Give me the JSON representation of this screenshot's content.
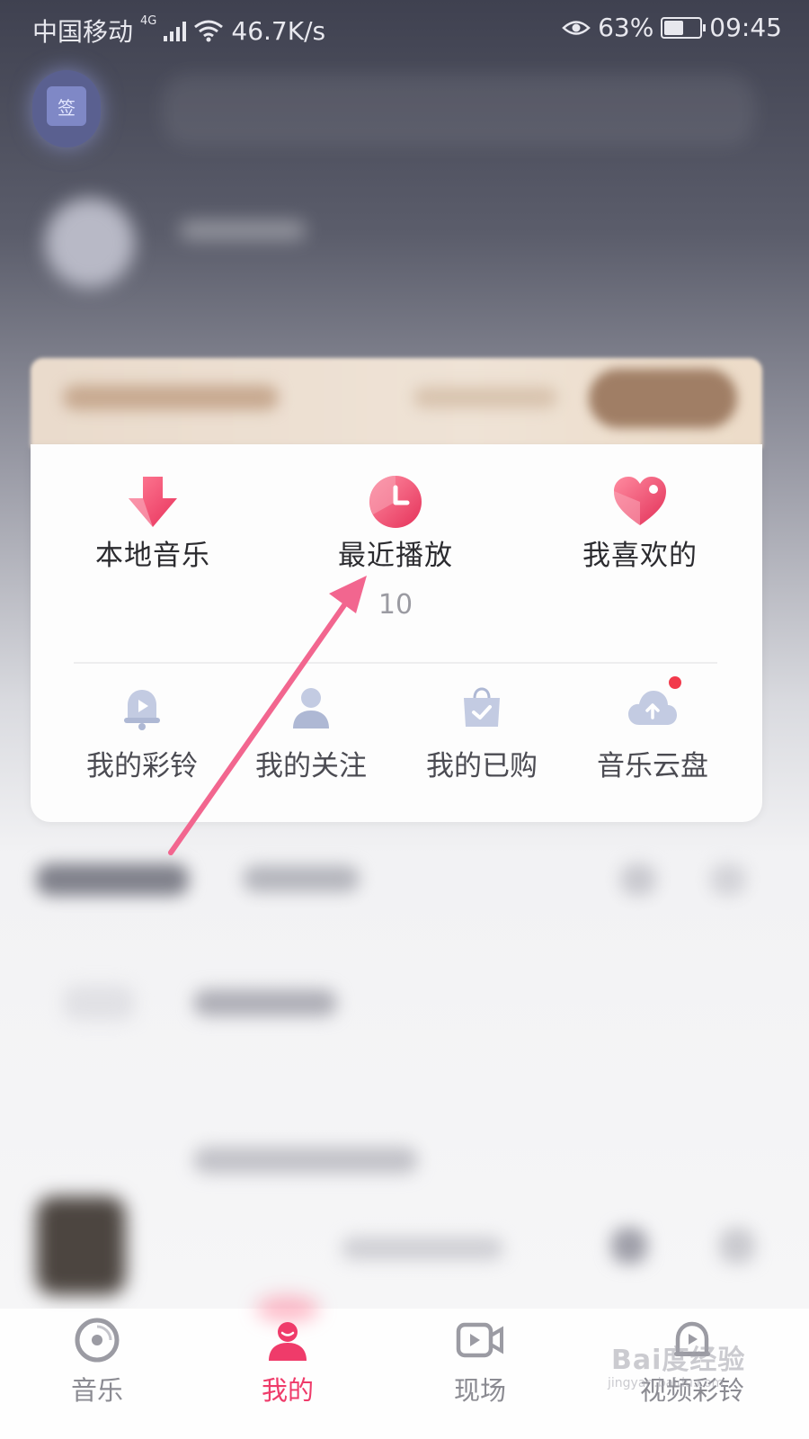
{
  "status_bar": {
    "carrier": "中国移动",
    "network": "4G",
    "speed": "46.7K/s",
    "battery": "63%",
    "battery_level": 0.63,
    "time": "09:45"
  },
  "header": {
    "checkin_char": "签"
  },
  "quick_access": [
    {
      "label": "本地音乐",
      "icon": "download-arrow-icon"
    },
    {
      "label": "最近播放",
      "icon": "clock-icon",
      "count": "10"
    },
    {
      "label": "我喜欢的",
      "icon": "heart-icon"
    }
  ],
  "features": [
    {
      "label": "我的彩铃",
      "icon": "bell-play-icon"
    },
    {
      "label": "我的关注",
      "icon": "person-icon"
    },
    {
      "label": "我的已购",
      "icon": "shopping-bag-check-icon"
    },
    {
      "label": "音乐云盘",
      "icon": "cloud-upload-icon",
      "badge": true
    }
  ],
  "tabbar": {
    "items": [
      {
        "label": "音乐",
        "icon": "music-disc-icon"
      },
      {
        "label": "我的",
        "icon": "user-icon",
        "active": true
      },
      {
        "label": "现场",
        "icon": "video-camera-icon"
      },
      {
        "label": "视频彩铃",
        "icon": "video-ringtone-icon"
      }
    ]
  },
  "watermark": {
    "text": "Bai度经验",
    "sub": "jingyan.baidu.com"
  },
  "colors": {
    "accent": "#ef3b6a",
    "icon_gray_blue": "#b7c0d8",
    "badge": "#f23a4c"
  }
}
